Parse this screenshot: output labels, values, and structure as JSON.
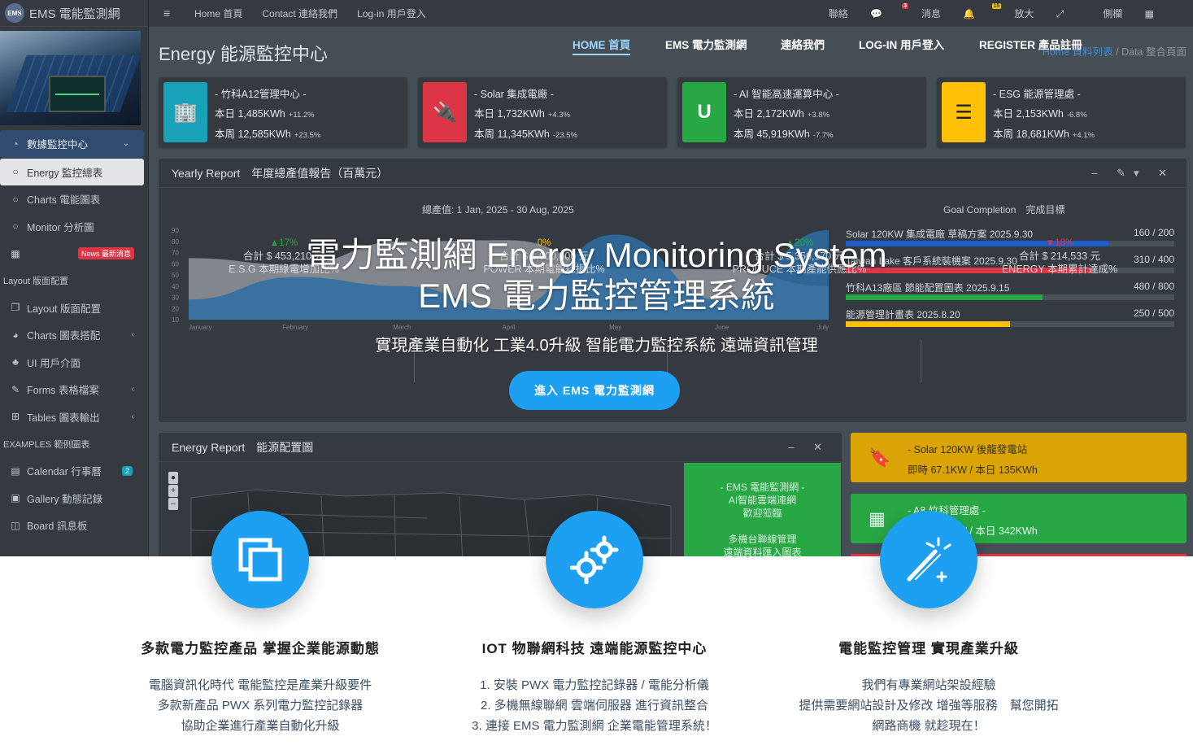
{
  "sidebar": {
    "brand": "EMS 電能監測網",
    "brand_logo": "EMS",
    "items": [
      {
        "label": "數據監控中心",
        "icon": "dashboard-icon",
        "caret": "⌄"
      },
      {
        "label": "Energy 監控總表",
        "icon": "circle-icon"
      },
      {
        "label": "Charts 電能圖表",
        "icon": "circle-icon"
      },
      {
        "label": "Monitor 分析圖",
        "icon": "circle-icon"
      },
      {
        "label": "",
        "icon": "grid-icon",
        "badge": "News 最新消息"
      }
    ],
    "header1": "Layout 版面配置",
    "items2": [
      {
        "label": "Layout 版面配置",
        "icon": "copy-icon"
      },
      {
        "label": "Charts 圖表搭配",
        "icon": "pie-chart-icon",
        "caret": "‹"
      },
      {
        "label": "UI 用戶介面",
        "icon": "tree-icon"
      },
      {
        "label": "Forms 表格檔案",
        "icon": "edit-icon",
        "caret": "‹"
      },
      {
        "label": "Tables 圖表輸出",
        "icon": "table-icon",
        "caret": "‹"
      }
    ],
    "header2": "EXAMPLES 範例圖表",
    "items3": [
      {
        "label": "Calendar 行事曆",
        "icon": "calendar-icon",
        "badge": "2"
      },
      {
        "label": "Gallery 動態記錄",
        "icon": "image-icon"
      },
      {
        "label": "Board 訊息板",
        "icon": "board-icon"
      }
    ]
  },
  "topbar": {
    "links": [
      "Home 首頁",
      "Contact 連絡我們",
      "Log-in 用戶登入"
    ],
    "right": [
      {
        "label": "聯絡",
        "icon": "chat-icon",
        "badge": "3",
        "badge_color": "#dc3545"
      },
      {
        "label": "消息",
        "icon": "bell-icon",
        "badge": "15",
        "badge_color": "#ffc107"
      },
      {
        "label": "放大",
        "icon": "expand-icon"
      },
      {
        "label": "側欄",
        "icon": "sidebar-icon"
      }
    ]
  },
  "mainnav": [
    "HOME 首頁",
    "EMS 電力監測網",
    "連絡我們",
    "LOG-IN 用戶登入",
    "REGISTER 產品註冊"
  ],
  "page": {
    "title": "Energy 能源監控中心",
    "crumb_active": "Home 資料列表",
    "crumb_sep": "/",
    "crumb_current": "Data 整合頁面"
  },
  "info_boxes": [
    {
      "name": "- 竹科A12管理中心 -",
      "day": "本日 1,485KWh",
      "day_pct": "+11.2%",
      "week": "本周 12,585KWh",
      "week_pct": "+23.5%",
      "color": "#17a2b8",
      "icon": "building-icon",
      "glyph": "🏢"
    },
    {
      "name": "- Solar 集成電廠 -",
      "day": "本日 1,732KWh",
      "day_pct": "+4.3%",
      "week": "本周 11,345KWh",
      "week_pct": "-23.5%",
      "color": "#dc3545",
      "icon": "plug-icon",
      "glyph": "🔌"
    },
    {
      "name": "- AI 智能高速運算中心 -",
      "day": "本日 2,172KWh",
      "day_pct": "+3.8%",
      "week": "本周 45,919KWh",
      "week_pct": "-7.7%",
      "color": "#28a745",
      "icon": "magnet-icon",
      "glyph": "U"
    },
    {
      "name": "- ESG 能源管理處 -",
      "day": "本日 2,153KWh",
      "day_pct": "-6.8%",
      "week": "本周 18,681KWh",
      "week_pct": "+4.1%",
      "color": "#ffc107",
      "icon": "server-icon",
      "glyph": "☰"
    }
  ],
  "yearly": {
    "title": "Yearly Report　年度總產值報告（百萬元）",
    "tools": "– ✎▾ ✕",
    "range_label": "總產值: 1 Jan, 2025 - 30 Aug, 2025",
    "goal_label": "Goal Completion　完成目標"
  },
  "chart_data": {
    "type": "area",
    "x": [
      "January",
      "February",
      "March",
      "April",
      "May",
      "June",
      "July"
    ],
    "y_ticks": [
      10,
      20,
      30,
      40,
      50,
      60,
      70,
      80,
      90
    ],
    "ylim": [
      10,
      90
    ],
    "series": [
      {
        "values": [
          65,
          59,
          80,
          81,
          56,
          55,
          40
        ],
        "color": "#8b9097"
      },
      {
        "values": [
          28,
          48,
          40,
          19,
          86,
          27,
          90
        ],
        "color": "#2e6da4"
      }
    ]
  },
  "goals": [
    {
      "label": "Solar 120KW 集成電廠 草稿方案 2025.9.30",
      "value": "160 / 200",
      "fraction": 0.8,
      "color": "#1e5cc9"
    },
    {
      "label": "Taiwan Lake 客戶系統裝機案 2025.9.30",
      "value": "310 / 400",
      "fraction": 0.75,
      "color": "#dc3545"
    },
    {
      "label": "竹科A13廠區 節能配置圖表 2025.9.15",
      "value": "480 / 800",
      "fraction": 0.6,
      "color": "#28a745"
    },
    {
      "label": "能源管理計畫表 2025.8.20",
      "value": "250 / 500",
      "fraction": 0.5,
      "color": "#ffc107"
    }
  ],
  "stats": [
    {
      "pct": "▲17%",
      "pct_color": "#28a745",
      "total": "合計 $ 453,210 元",
      "label": "E.S.G 本期綠電增加比%"
    },
    {
      "pct": "0%",
      "pct_color": "#ffc107",
      "total": "合計 $ 1,000,000 元",
      "label": "POWER 本期電能耗損比%"
    },
    {
      "pct": "▲20%",
      "pct_color": "#28a745",
      "total": "合計 $ 5,350,170 元",
      "label": "PRODUCE 本期產能供應比%"
    },
    {
      "pct": "▼18%",
      "pct_color": "#dc3545",
      "total": "合計 $ 214,533 元",
      "label": "ENERGY 本期累計達成%"
    }
  ],
  "energy_report": {
    "title": "Energy Report　能源配置圖",
    "tools": "– ✕",
    "zoom": [
      "●",
      "+",
      "–"
    ],
    "green_panel": [
      "- EMS 電能監測網 -",
      "AI智能雲端連網",
      "歡迎蒞臨",
      "",
      "多機台聯線管理",
      "遠端資料匯入圖表"
    ]
  },
  "small_boxes": [
    {
      "line1": "- Solar 120KW 後龍發電站",
      "line2": "即時 67.1KW / 本日 135KWh",
      "color": "#d9a404",
      "text_color": "#3a2f00",
      "icon": "bookmark-icon",
      "glyph": "🔖"
    },
    {
      "line1": "- A8 竹科管理處 -",
      "line2": "即時 41.3KW / 本日 342KWh",
      "color": "#28a745",
      "text_color": "#eaf8ee",
      "icon": "calculator-icon",
      "glyph": "▦"
    }
  ],
  "hero": {
    "title1": "電力監測網 Energy Monitoring System",
    "title2": "EMS 電力監控管理系統",
    "subtitle": "實現產業自動化 工業4.0升級 智能電力監控系統 遠端資訊管理",
    "cta": "進入 EMS 電力監測網"
  },
  "features": [
    {
      "icon": "layers-icon",
      "title": "多款電力監控產品 掌握企業能源動態",
      "lines": [
        "電腦資訊化時代 電能監控是產業升級要件",
        "多款新產品 PWX 系列電力監控記錄器",
        "協助企業進行產業自動化升級"
      ]
    },
    {
      "icon": "gears-icon",
      "title": "IOT 物聯網科技 遠端能源監控中心",
      "lines": [
        "1. 安裝 PWX 電力監控記錄器 / 電能分析儀",
        "2. 多機無線聯網 雲端伺服器 進行資訊整合",
        "3. 連接 EMS 電力監測網 企業電能管理系統！"
      ]
    },
    {
      "icon": "magic-wand-icon",
      "title": "電能監控管理 實現產業升級",
      "lines": [
        "我們有專業網站架設經驗",
        "提供需要網站設計及修改 增強等服務　幫您開拓",
        "網路商機 就趁現在！"
      ]
    }
  ]
}
